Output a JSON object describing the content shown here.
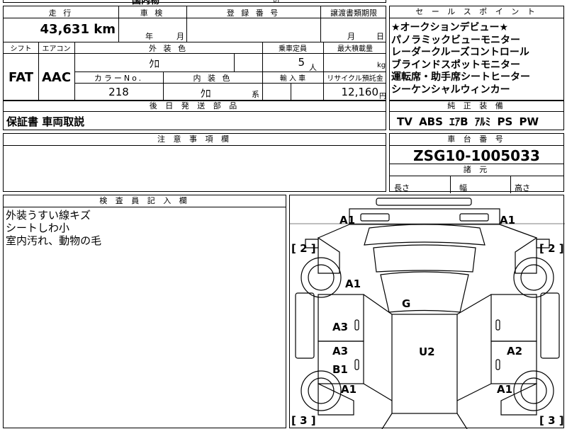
{
  "top_fragments": {
    "a": "国内物",
    "b": "計"
  },
  "mileage": {
    "label": "走 行",
    "value": "43,631",
    "unit": "km"
  },
  "inspection": {
    "label": "車 検",
    "year": "年",
    "month": "月"
  },
  "registration": {
    "label": "登 録 番 号"
  },
  "transfer": {
    "label": "譲渡書類期限",
    "month": "月",
    "day": "日"
  },
  "shift": {
    "label": "シフト",
    "value": "FAT"
  },
  "aircon": {
    "label": "エアコン",
    "value": "AAC"
  },
  "exterior_color": {
    "label": "外 装 色",
    "value": "ｸﾛ"
  },
  "capacity": {
    "label": "乗車定員",
    "value": "5",
    "unit": "人"
  },
  "max_load": {
    "label": "最大積載量",
    "unit": "kg"
  },
  "color_no": {
    "label": "カラーNo.",
    "value": "218"
  },
  "interior_color": {
    "label": "内 装 色",
    "value": "ｸﾛ",
    "suffix": "系"
  },
  "import": {
    "label": "輸 入 車"
  },
  "recycle": {
    "label": "リサイクル預託金",
    "value": "12,160",
    "unit": "円"
  },
  "sales_points": {
    "label": "セ ー ル ス ポ イ ン ト",
    "items": [
      "★オークションデビュー★",
      "パノラミックビューモニター",
      "レーダークルーズコントロール",
      "ブラインドスポットモニター",
      "運転席・助手席シートヒーター",
      "シーケンシャルウィンカー"
    ]
  },
  "later_parts": {
    "label": "後 日 発 送 部 品",
    "value": "保証書 車両取説"
  },
  "standard_equipment": {
    "label": "純 正 装 備",
    "value": "TV ABS ｴｱB ｱﾙﾐ PS PW"
  },
  "notes": {
    "label": "注 意 事 項 欄"
  },
  "chassis": {
    "label": "車 台 番 号",
    "value": "ZSG10-1005033"
  },
  "dimensions": {
    "label": "諸 元",
    "length": "長さ",
    "width": "幅",
    "height": "高さ"
  },
  "inspector": {
    "label": "検 査 員 記 入 欄",
    "lines": [
      "外装うすい線キズ",
      "シートしわ小",
      "室内汚れ、動物の毛"
    ]
  },
  "diagram": {
    "marks": {
      "a1_front_left": "A1",
      "a1_front_right": "A1",
      "a1_hood": "A1",
      "g_windshield": "G",
      "a3_left_front_door": "A3",
      "a3_left_rear_door": "A3",
      "b1_left_rear_door": "B1",
      "u2_roof": "U2",
      "a2_right_rear_door": "A2",
      "a1_left_rear": "A1",
      "a1_right_rear": "A1",
      "tire_fl": "[ 2 ]",
      "tire_fr": "[ 2 ]",
      "tire_rl": "[ 3 ]",
      "tire_rr": "[ 3 ]"
    }
  }
}
